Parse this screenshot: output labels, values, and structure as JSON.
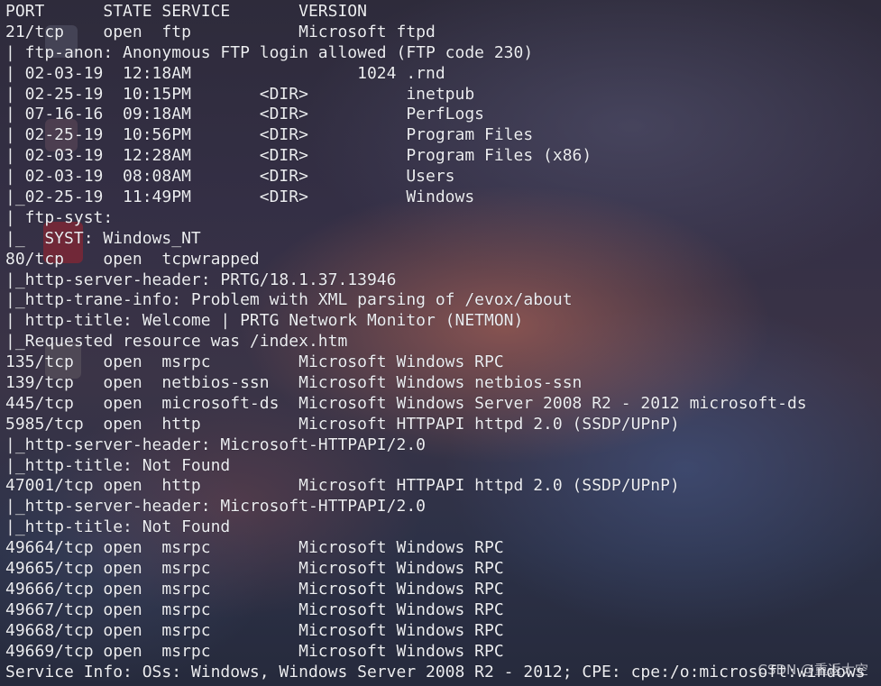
{
  "terminal": {
    "lines": [
      "PORT      STATE SERVICE       VERSION",
      "21/tcp    open  ftp           Microsoft ftpd",
      "| ftp-anon: Anonymous FTP login allowed (FTP code 230)",
      "| 02-03-19  12:18AM                 1024 .rnd",
      "| 02-25-19  10:15PM       <DIR>          inetpub",
      "| 07-16-16  09:18AM       <DIR>          PerfLogs",
      "| 02-25-19  10:56PM       <DIR>          Program Files",
      "| 02-03-19  12:28AM       <DIR>          Program Files (x86)",
      "| 02-03-19  08:08AM       <DIR>          Users",
      "|_02-25-19  11:49PM       <DIR>          Windows",
      "| ftp-syst:",
      "|_  SYST: Windows_NT",
      "80/tcp    open  tcpwrapped",
      "|_http-server-header: PRTG/18.1.37.13946",
      "|_http-trane-info: Problem with XML parsing of /evox/about",
      "| http-title: Welcome | PRTG Network Monitor (NETMON)",
      "|_Requested resource was /index.htm",
      "135/tcp   open  msrpc         Microsoft Windows RPC",
      "139/tcp   open  netbios-ssn   Microsoft Windows netbios-ssn",
      "445/tcp   open  microsoft-ds  Microsoft Windows Server 2008 R2 - 2012 microsoft-ds",
      "5985/tcp  open  http          Microsoft HTTPAPI httpd 2.0 (SSDP/UPnP)",
      "|_http-server-header: Microsoft-HTTPAPI/2.0",
      "|_http-title: Not Found",
      "47001/tcp open  http          Microsoft HTTPAPI httpd 2.0 (SSDP/UPnP)",
      "|_http-server-header: Microsoft-HTTPAPI/2.0",
      "|_http-title: Not Found",
      "49664/tcp open  msrpc         Microsoft Windows RPC",
      "49665/tcp open  msrpc         Microsoft Windows RPC",
      "49666/tcp open  msrpc         Microsoft Windows RPC",
      "49667/tcp open  msrpc         Microsoft Windows RPC",
      "49668/tcp open  msrpc         Microsoft Windows RPC",
      "49669/tcp open  msrpc         Microsoft Windows RPC",
      "Service Info: OSs: Windows, Windows Server 2008 R2 - 2012; CPE: cpe:/o:microsoft:windows"
    ]
  },
  "watermark": "CSDN @重返太空",
  "colors": {
    "text": "#ecedf1",
    "background": "#2e2b3b"
  }
}
